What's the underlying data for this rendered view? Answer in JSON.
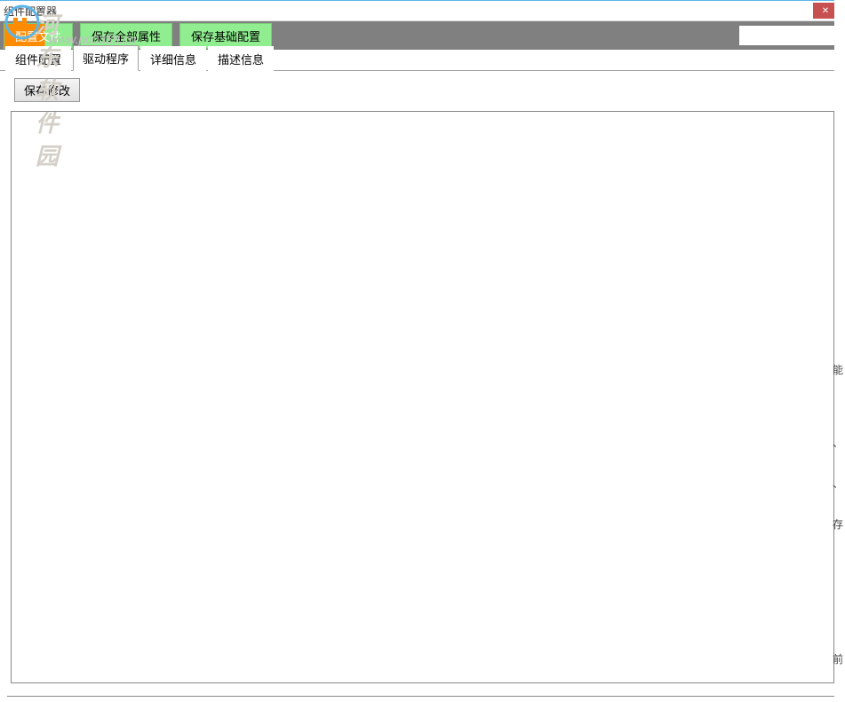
{
  "window": {
    "title": "组件配置器"
  },
  "watermark": {
    "main_text": "河东软件园",
    "url_text": "www.pc0359.cn"
  },
  "toolbar": {
    "config_file_label": "配置文件",
    "save_all_label": "保存全部属性",
    "save_basic_label": "保存基础配置",
    "search_placeholder": ""
  },
  "tabs": {
    "component_config": "组件配置",
    "driver": "驱动程序",
    "detail_info": "详细信息",
    "description": "描述信息",
    "active_index": 1
  },
  "content": {
    "save_changes_label": "保存修改",
    "textarea_value": ""
  },
  "right_fragments": {
    "frag1": "能",
    "frag2": "、",
    "frag3": "、",
    "frag4": "存",
    "frag5": "前"
  }
}
